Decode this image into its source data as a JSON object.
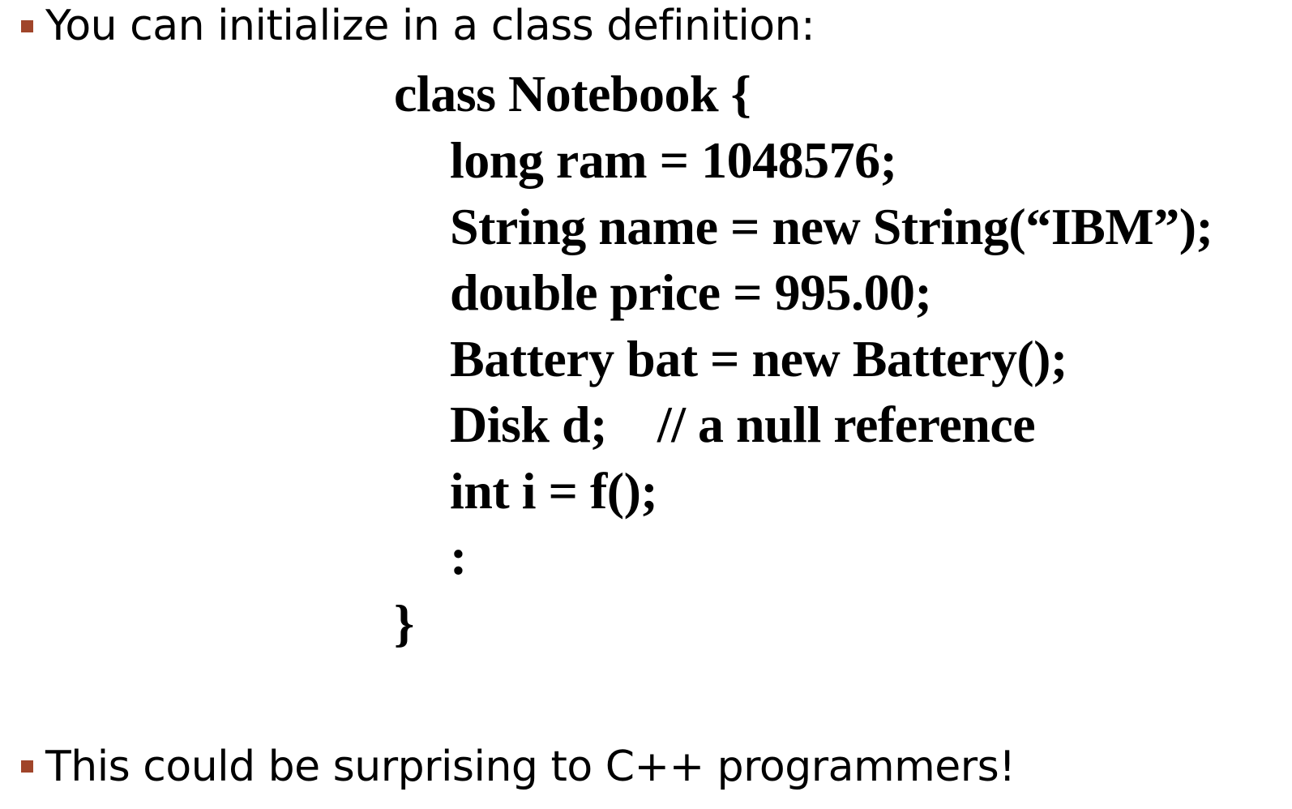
{
  "slide": {
    "bullets": [
      {
        "text": "You can initialize in a class definition:"
      },
      {
        "text": "This could be surprising to C++ programmers!"
      }
    ],
    "code_lines": [
      "class Notebook {",
      "long ram = 1048576;",
      "String name = new String(“IBM”);",
      "double price = 995.00;",
      "Battery bat = new Battery();",
      "Disk d;    // a null reference",
      "int i = f();",
      ":",
      "}"
    ]
  },
  "colors": {
    "bullet_marker": "#a0452a",
    "text": "#000000",
    "background": "#ffffff"
  }
}
